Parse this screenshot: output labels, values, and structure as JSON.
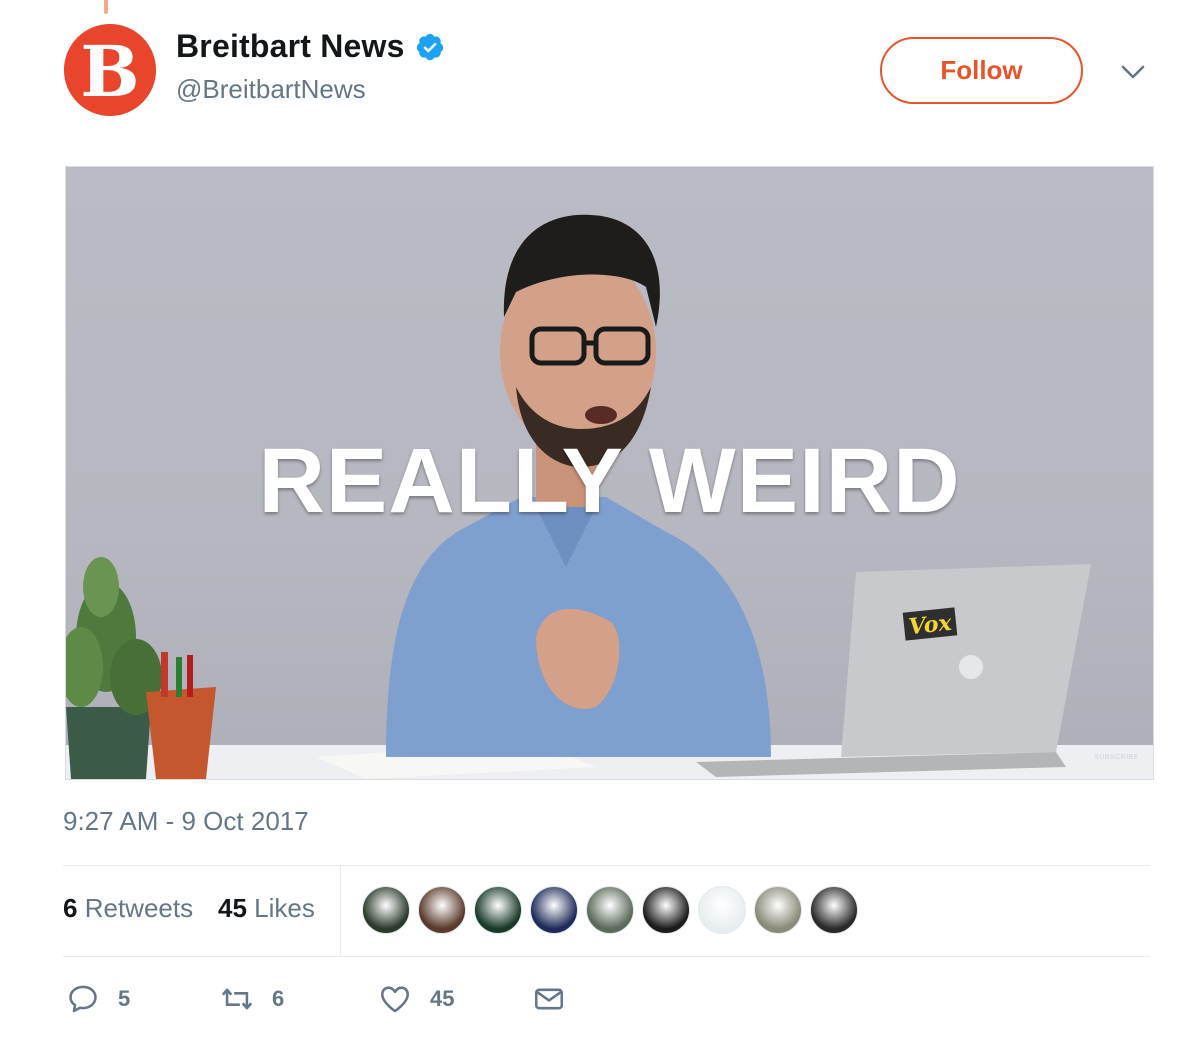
{
  "tweet": {
    "author": {
      "display_name": "Breitbart News",
      "handle": "@BreitbartNews",
      "avatar_letter": "B",
      "brand_color": "#e8452c",
      "verified": true
    },
    "follow_label": "Follow",
    "media": {
      "caption": "REALLY WEIRD",
      "laptop_sticker": "Vox",
      "watermark": "SUBSCRIBE"
    },
    "timestamp": "9:27 AM - 9 Oct 2017",
    "stats": {
      "retweets_count": "6",
      "retweets_label": "Retweets",
      "likes_count": "45",
      "likes_label": "Likes"
    },
    "likers": [
      {
        "color": "#2b3a2b"
      },
      {
        "color": "#5a3a2a"
      },
      {
        "color": "#1a3a2a"
      },
      {
        "color": "#1f2b5a"
      },
      {
        "color": "#5b6a5a"
      },
      {
        "color": "#1c1c1c"
      },
      {
        "color": "#e8eef0"
      },
      {
        "color": "#8a8a7a"
      },
      {
        "color": "#2a2a2a"
      }
    ],
    "actions": {
      "reply_count": "5",
      "retweet_count": "6",
      "like_count": "45"
    },
    "colors": {
      "accent": "#e8542a",
      "muted_text": "#657786",
      "verified_blue": "#1da1f2"
    }
  }
}
